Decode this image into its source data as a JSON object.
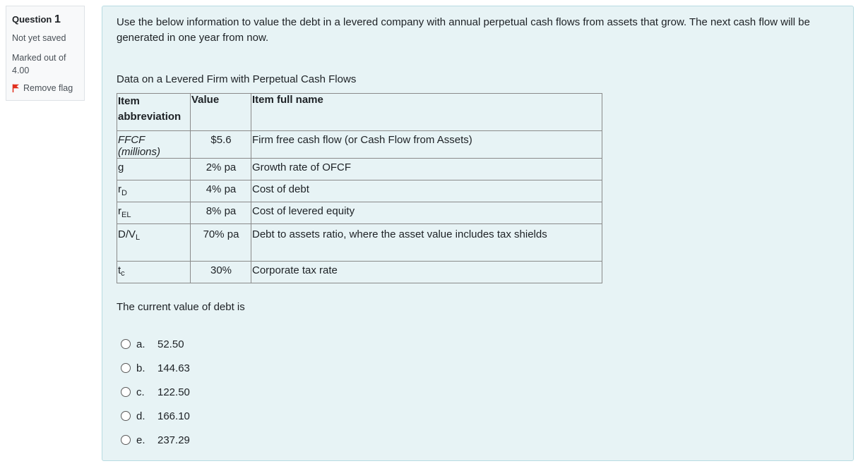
{
  "info": {
    "question_label": "Question",
    "question_number": "1",
    "state": "Not yet saved",
    "grade": "Marked out of 4.00",
    "flag_label": "Remove flag",
    "flag_icon": "red-flag-icon",
    "flag_color": "#e12f1d"
  },
  "question": {
    "text": "Use the below information to value the debt in a levered company with annual perpetual cash flows from assets that grow. The next cash flow will be generated in one year from now.",
    "caption": "Data on a Levered Firm with Perpetual Cash Flows",
    "table": {
      "headers": [
        "Item abbreviation",
        "Value",
        "Item full name"
      ],
      "rows": [
        {
          "abbr_main": "FFCF (millions)",
          "abbr_sub": "",
          "value": "$5.6",
          "name": "Firm free cash flow (or Cash Flow from Assets)"
        },
        {
          "abbr_main": "g",
          "abbr_sub": "",
          "value": "2% pa",
          "name": "Growth rate of OFCF"
        },
        {
          "abbr_main": "r",
          "abbr_sub": "D",
          "value": "4% pa",
          "name": "Cost of debt"
        },
        {
          "abbr_main": "r",
          "abbr_sub": "EL",
          "value": "8% pa",
          "name": "Cost of levered equity"
        },
        {
          "abbr_main": "D/V",
          "abbr_sub": "L",
          "value": "70% pa",
          "name": "Debt to assets ratio, where the asset value includes tax shields"
        },
        {
          "abbr_main": "t",
          "abbr_sub": "c",
          "value": "30%",
          "name": "Corporate tax rate"
        }
      ]
    },
    "prompt": "The current value of debt is",
    "options": [
      {
        "letter": "a.",
        "value": "52.50"
      },
      {
        "letter": "b.",
        "value": "144.63"
      },
      {
        "letter": "c.",
        "value": "122.50"
      },
      {
        "letter": "d.",
        "value": "166.10"
      },
      {
        "letter": "e.",
        "value": "237.29"
      }
    ]
  }
}
